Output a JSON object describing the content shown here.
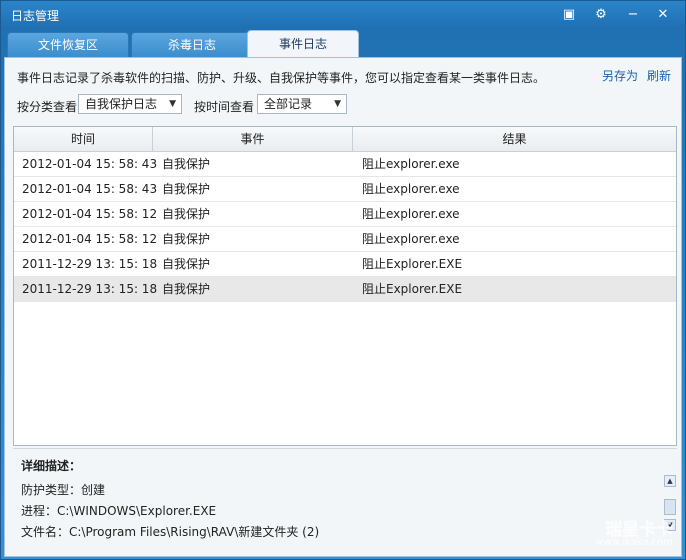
{
  "window": {
    "title": "日志管理",
    "controls": {
      "menu": "▣",
      "settings": "⚙",
      "minimize": "−",
      "close": "✕"
    }
  },
  "tabs": [
    {
      "label": "文件恢复区"
    },
    {
      "label": "杀毒日志"
    },
    {
      "label": "事件日志"
    }
  ],
  "main": {
    "description": "事件日志记录了杀毒软件的扫描、防护、升级、自我保护等事件，您可以指定查看某一类事件日志。",
    "save_as": "另存为",
    "refresh": "刷新",
    "category_label": "按分类查看",
    "category_value": "自我保护日志",
    "time_label": "按时间查看",
    "time_value": "全部记录"
  },
  "table": {
    "headers": [
      "时间",
      "事件",
      "结果"
    ],
    "rows": [
      {
        "time": "2012-01-04 15: 58: 43",
        "event": "自我保护",
        "result": "阻止explorer.exe"
      },
      {
        "time": "2012-01-04 15: 58: 43",
        "event": "自我保护",
        "result": "阻止explorer.exe"
      },
      {
        "time": "2012-01-04 15: 58: 12",
        "event": "自我保护",
        "result": "阻止explorer.exe"
      },
      {
        "time": "2012-01-04 15: 58: 12",
        "event": "自我保护",
        "result": "阻止explorer.exe"
      },
      {
        "time": "2011-12-29 13: 15: 18",
        "event": "自我保护",
        "result": "阻止Explorer.EXE"
      },
      {
        "time": "2011-12-29 13: 15: 18",
        "event": "自我保护",
        "result": "阻止Explorer.EXE"
      }
    ]
  },
  "details": {
    "title": "详细描述：",
    "lines": [
      "防护类型：创建",
      "进程：C:\\WINDOWS\\Explorer.EXE",
      "文件名：C:\\Program Files\\Rising\\RAV\\新建文件夹 (2)"
    ]
  },
  "watermark": {
    "brand": "瑞星卡卡",
    "url": "www.ikaka.com"
  }
}
